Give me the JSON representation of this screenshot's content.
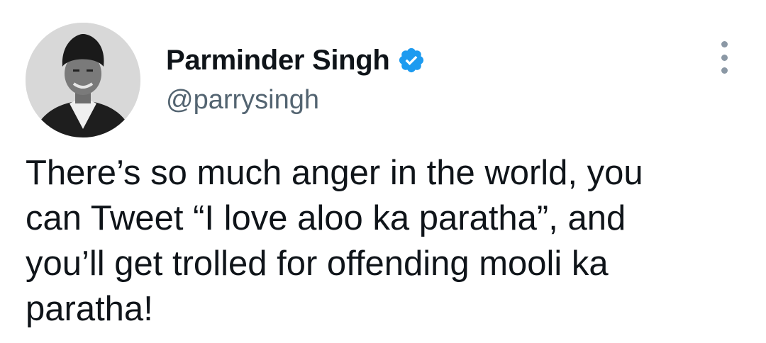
{
  "tweet": {
    "author": {
      "display_name": "Parminder Singh",
      "handle": "@parrysingh",
      "verified_icon": "verified-badge-icon",
      "avatar": "profile-photo"
    },
    "text": "There’s so much anger in the world, you\ncan Tweet “I love aloo ka paratha”, and\nyou’ll get trolled for offending mooli ka\nparatha!",
    "more_icon": "more-options-icon"
  },
  "colors": {
    "text_primary": "#0f1419",
    "text_secondary": "#536471",
    "verified_blue": "#1d9bf0",
    "icon_gray": "#8b98a5"
  }
}
